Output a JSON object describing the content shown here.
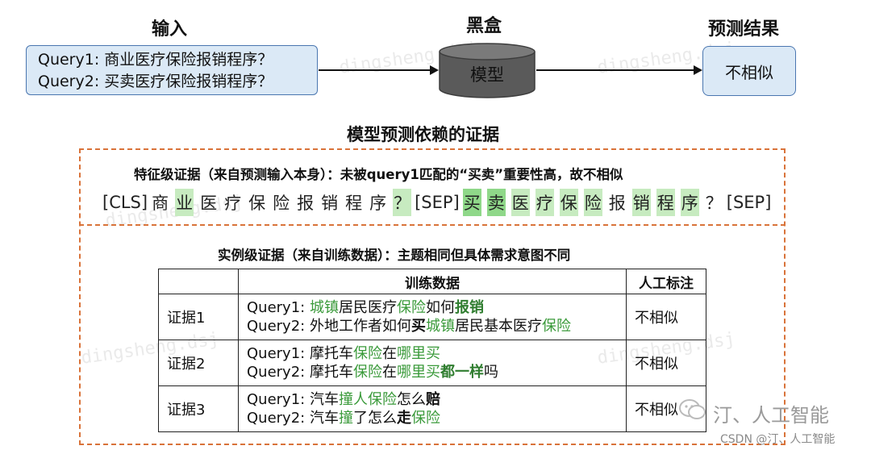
{
  "top": {
    "input_title": "输入",
    "blackbox_title": "黑盒",
    "result_title": "预测结果",
    "query1": "Query1: 商业医疗保险报销程序？",
    "query2": "Query2: 买卖医疗保险报销程序？",
    "model_label": "模型",
    "result_label": "不相似"
  },
  "evidence_title": "模型预测依赖的证据",
  "feature": {
    "heading": "特征级证据（来自预测输入本身）：未被query1匹配的“买卖”重要性高，故不相似",
    "tokens": [
      {
        "t": "[CLS]",
        "hl": "",
        "special": true
      },
      {
        "t": "商",
        "hl": ""
      },
      {
        "t": "业",
        "hl": "light"
      },
      {
        "t": "医",
        "hl": ""
      },
      {
        "t": "疗",
        "hl": ""
      },
      {
        "t": "保",
        "hl": ""
      },
      {
        "t": "险",
        "hl": ""
      },
      {
        "t": "报",
        "hl": ""
      },
      {
        "t": "销",
        "hl": ""
      },
      {
        "t": "程",
        "hl": ""
      },
      {
        "t": "序",
        "hl": ""
      },
      {
        "t": "？",
        "hl": "light",
        "special": true
      },
      {
        "t": "[SEP]",
        "hl": "",
        "special": true
      },
      {
        "t": "买",
        "hl": "med"
      },
      {
        "t": "卖",
        "hl": "med"
      },
      {
        "t": "医",
        "hl": "light"
      },
      {
        "t": "疗",
        "hl": "light"
      },
      {
        "t": "保",
        "hl": "light"
      },
      {
        "t": "险",
        "hl": "light"
      },
      {
        "t": "报",
        "hl": ""
      },
      {
        "t": "销",
        "hl": "light"
      },
      {
        "t": "程",
        "hl": "light"
      },
      {
        "t": "序",
        "hl": "light"
      },
      {
        "t": "？",
        "hl": "",
        "special": true
      },
      {
        "t": "[SEP]",
        "hl": "",
        "special": true
      }
    ]
  },
  "instance": {
    "heading": "实例级证据（来自训练数据）：主题相同但具体需求意图不同",
    "col_data": "训练数据",
    "col_label": "人工标注",
    "rows": [
      {
        "id": "证据1",
        "q1": [
          {
            "t": "Query1: ",
            "s": ""
          },
          {
            "t": "城镇",
            "s": "g"
          },
          {
            "t": "居民医疗",
            "s": ""
          },
          {
            "t": "保险",
            "s": "g"
          },
          {
            "t": "如何",
            "s": ""
          },
          {
            "t": "报销",
            "s": "gb"
          }
        ],
        "q2": [
          {
            "t": "Query2: 外地工作者如何",
            "s": ""
          },
          {
            "t": "买",
            "s": "kb"
          },
          {
            "t": "城镇",
            "s": "g"
          },
          {
            "t": "居民基本医疗",
            "s": ""
          },
          {
            "t": "保险",
            "s": "g"
          }
        ],
        "label": "不相似"
      },
      {
        "id": "证据2",
        "q1": [
          {
            "t": "Query1: 摩托车",
            "s": ""
          },
          {
            "t": "保险",
            "s": "g"
          },
          {
            "t": "在",
            "s": ""
          },
          {
            "t": "哪里买",
            "s": "g"
          }
        ],
        "q2": [
          {
            "t": "Query2: 摩托车",
            "s": ""
          },
          {
            "t": "保险",
            "s": "g"
          },
          {
            "t": "在",
            "s": ""
          },
          {
            "t": "哪里买",
            "s": "g"
          },
          {
            "t": "都一样",
            "s": "gb"
          },
          {
            "t": "吗",
            "s": ""
          }
        ],
        "label": "不相似"
      },
      {
        "id": "证据3",
        "q1": [
          {
            "t": "Query1: 汽车",
            "s": ""
          },
          {
            "t": "撞人保险",
            "s": "g"
          },
          {
            "t": "怎么",
            "s": ""
          },
          {
            "t": "赔",
            "s": "kb"
          }
        ],
        "q2": [
          {
            "t": "Query2: 汽车",
            "s": ""
          },
          {
            "t": "撞",
            "s": "g"
          },
          {
            "t": "了怎么",
            "s": ""
          },
          {
            "t": "走",
            "s": "kb"
          },
          {
            "t": "保险",
            "s": "g"
          }
        ],
        "label": "不相似"
      }
    ]
  },
  "watermarks": {
    "logo_text": "汀、人工智能",
    "credit": "CSDN @汀、人工智能"
  },
  "colors": {
    "box_fill": "#dbe9f6",
    "box_border": "#4a76b0",
    "dash": "#d9733a",
    "green": "#3a9a3a",
    "highlight_light": "#c7ebc0",
    "highlight_med": "#8fd889",
    "cylinder": "#5a5a5a"
  }
}
